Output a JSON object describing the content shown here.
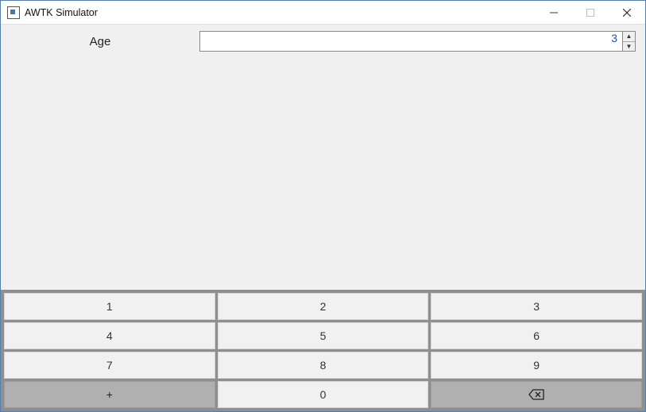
{
  "window": {
    "title": "AWTK Simulator"
  },
  "form": {
    "age": {
      "label": "Age",
      "value": "3"
    }
  },
  "keypad": {
    "keys": [
      "1",
      "2",
      "3",
      "4",
      "5",
      "6",
      "7",
      "8",
      "9",
      "+",
      "0"
    ],
    "backspace_icon": "⌫"
  }
}
